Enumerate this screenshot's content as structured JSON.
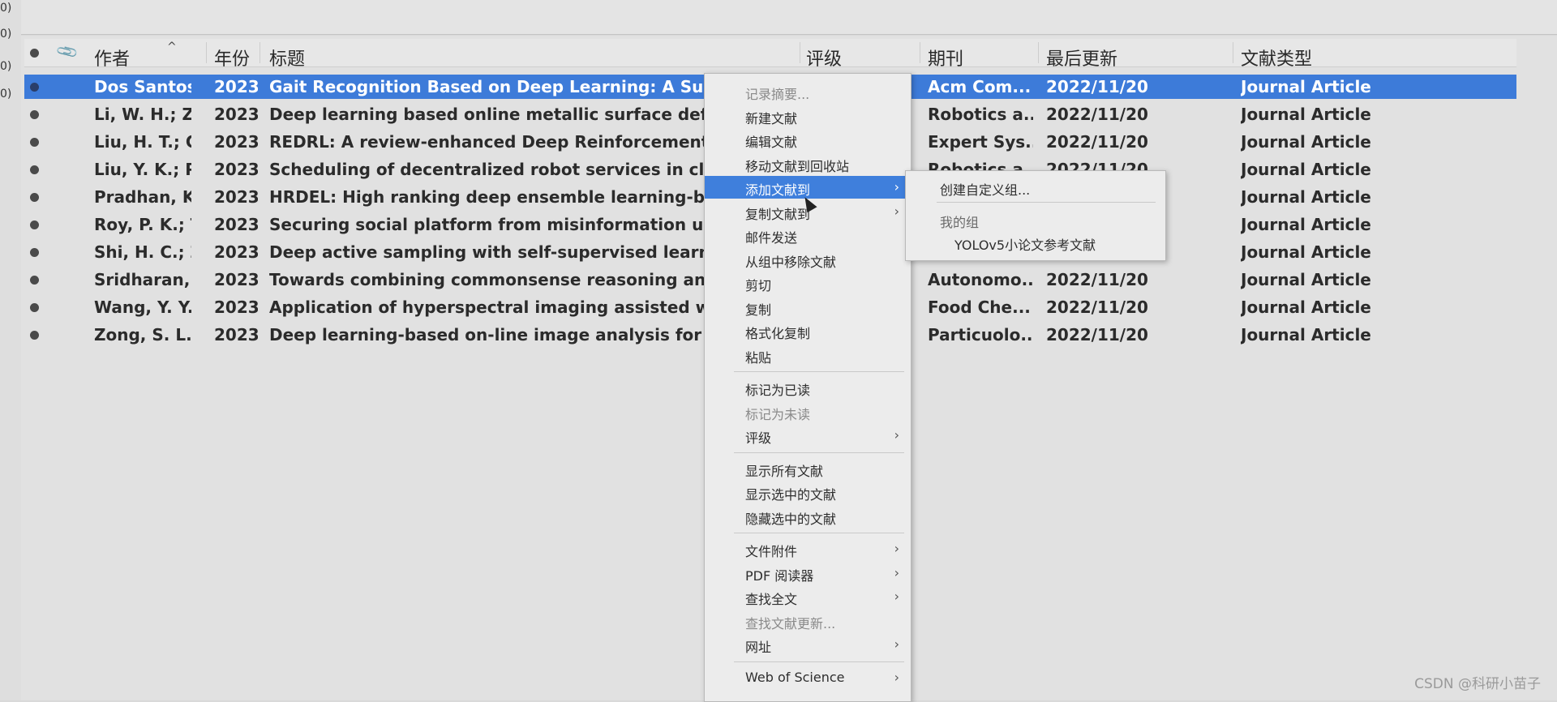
{
  "left_strip": [
    "0)",
    "0)",
    "0)",
    "0)"
  ],
  "columns": {
    "author": "作者",
    "year": "年份",
    "title": "标题",
    "rating": "评级",
    "journal": "期刊",
    "updated": "最后更新",
    "type": "文献类型",
    "sort_indicator": "^"
  },
  "rows": [
    {
      "author": "Dos Santos,...",
      "year": "2023",
      "title": "Gait Recognition Based on Deep Learning: A Survey",
      "journal": "Acm Com...",
      "updated": "2022/11/20",
      "type": "Journal Article",
      "selected": true
    },
    {
      "author": "Li, W. H.; Zh...",
      "year": "2023",
      "title": "Deep learning based online metallic surface defect de",
      "journal": "Robotics a...",
      "updated": "2022/11/20",
      "type": "Journal Article"
    },
    {
      "author": "Liu, H. T.; Ca...",
      "year": "2023",
      "title": "REDRL: A review-enhanced Deep Reinforcement Learn",
      "journal": "Expert Sys...",
      "updated": "2022/11/20",
      "type": "Journal Article"
    },
    {
      "author": "Liu, Y. K.; Pi...",
      "year": "2023",
      "title": "Scheduling of decentralized robot services in cloud m",
      "journal": "Robotics a...",
      "updated": "2022/11/20",
      "type": "Journal Article"
    },
    {
      "author": "Pradhan, K. ...",
      "year": "2023",
      "title": "HRDEL: High ranking deep ensemble learning-based",
      "journal": "",
      "updated": "",
      "type": "Journal Article"
    },
    {
      "author": "Roy, P. K.; Tr...",
      "year": "2023",
      "title": "Securing social platform from misinformation using c",
      "journal": "",
      "updated": "",
      "type": "Journal Article"
    },
    {
      "author": "Shi, H. C.; Z...",
      "year": "2023",
      "title": "Deep active sampling with self-supervised learning",
      "journal": "",
      "updated": "",
      "type": "Journal Article"
    },
    {
      "author": "Sridharan, ...",
      "year": "2023",
      "title": "Towards combining commonsense reasoning and kno",
      "journal": "Autonomo...",
      "updated": "2022/11/20",
      "type": "Journal Article"
    },
    {
      "author": "Wang, Y. Y.; ...",
      "year": "2023",
      "title": "Application of hyperspectral imaging assisted with in",
      "journal": "Food Che...",
      "updated": "2022/11/20",
      "type": "Journal Article"
    },
    {
      "author": "Zong, S. L.; ...",
      "year": "2023",
      "title": "Deep learning-based on-line image analysis for conti",
      "journal": "Particuolo...",
      "updated": "2022/11/20",
      "type": "Journal Article"
    }
  ],
  "context_menu": [
    {
      "label": "记录摘要...",
      "disabled": true
    },
    {
      "label": "新建文献"
    },
    {
      "label": "编辑文献"
    },
    {
      "label": "移动文献到回收站"
    },
    {
      "label": "添加文献到",
      "submenu": true,
      "highlighted": true
    },
    {
      "label": "复制文献到",
      "submenu": true
    },
    {
      "label": "邮件发送"
    },
    {
      "label": "从组中移除文献"
    },
    {
      "label": "剪切"
    },
    {
      "label": "复制"
    },
    {
      "label": "格式化复制"
    },
    {
      "label": "粘贴"
    },
    {
      "separator": true
    },
    {
      "label": "标记为已读"
    },
    {
      "label": "标记为未读",
      "disabled": true
    },
    {
      "label": "评级",
      "submenu": true
    },
    {
      "separator": true
    },
    {
      "label": "显示所有文献"
    },
    {
      "label": "显示选中的文献"
    },
    {
      "label": "隐藏选中的文献"
    },
    {
      "separator": true
    },
    {
      "label": "文件附件",
      "submenu": true
    },
    {
      "label": "PDF 阅读器",
      "submenu": true
    },
    {
      "label": "查找全文",
      "submenu": true
    },
    {
      "label": "查找文献更新...",
      "disabled": true
    },
    {
      "label": "网址",
      "submenu": true
    },
    {
      "separator": true
    },
    {
      "label": "Web of Science",
      "submenu": true
    }
  ],
  "submenu": {
    "create_group": "创建自定义组...",
    "my_groups_header": "我的组",
    "group_item": "YOLOv5小论文参考文献"
  },
  "watermark": "CSDN @科研小苗子",
  "colors": {
    "selection": "#3d7bd9",
    "menu_highlight": "#3f7fdc"
  }
}
